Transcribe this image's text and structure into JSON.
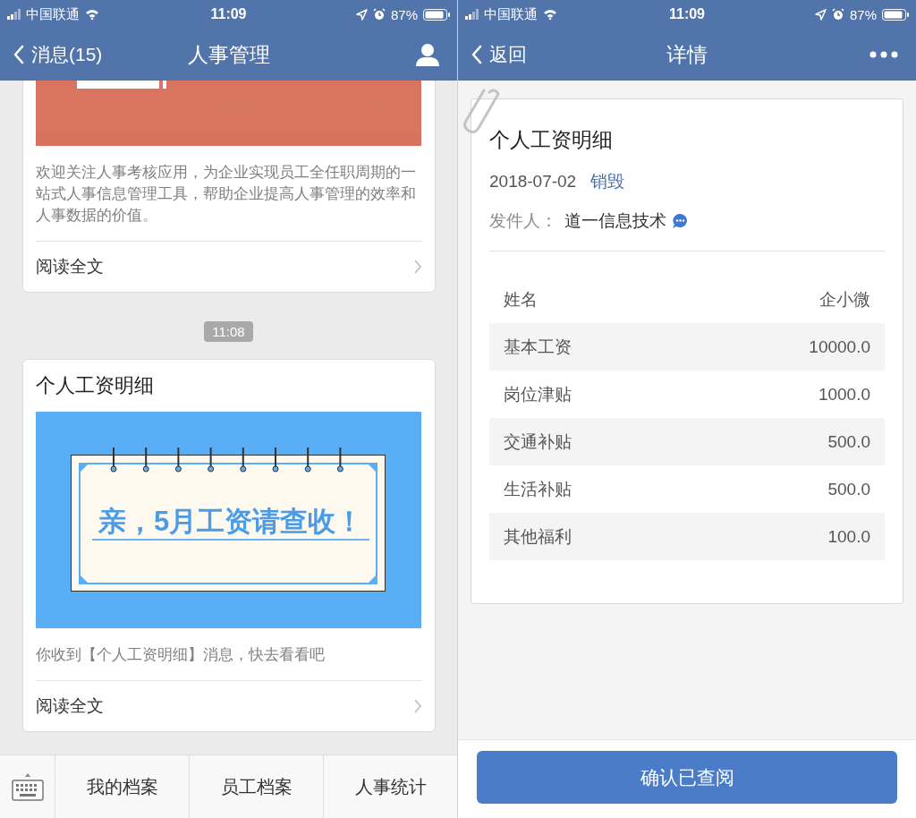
{
  "left_screen": {
    "status_bar": {
      "carrier": "中国联通",
      "time": "11:09",
      "battery": "87%"
    },
    "nav": {
      "back": "消息(15)",
      "title": "人事管理"
    },
    "messages": [
      {
        "kind": "article",
        "description": "欢迎关注人事考核应用，为企业实现员工全任职周期的一站式人事信息管理工具，帮助企业提高人事管理的效率和人事数据的价值。",
        "link": "阅读全文"
      },
      {
        "kind": "timestamp",
        "text": "11:08"
      },
      {
        "kind": "article",
        "title": "个人工资明细",
        "image": {
          "kind": "banner",
          "text": "亲，5月工资请查收！"
        },
        "description": "你收到【个人工资明细】消息，快去看看吧",
        "link": "阅读全文"
      }
    ],
    "menu": [
      "我的档案",
      "员工档案",
      "人事统计"
    ]
  },
  "right_screen": {
    "status_bar": {
      "carrier": "中国联通",
      "time": "11:09",
      "battery": "87%"
    },
    "nav": {
      "back": "返回",
      "title": "详情"
    },
    "detail": {
      "title": "个人工资明细",
      "date": "2018-07-02",
      "action": "销毁",
      "sender_label": "发件人：",
      "sender": "道一信息技术",
      "table": {
        "header": [
          "姓名",
          "企小微"
        ],
        "rows": [
          [
            "基本工资",
            "10000.0"
          ],
          [
            "岗位津贴",
            "1000.0"
          ],
          [
            "交通补贴",
            "500.0"
          ],
          [
            "生活补贴",
            "500.0"
          ],
          [
            "其他福利",
            "100.0"
          ]
        ]
      }
    },
    "button": "确认已查阅"
  }
}
